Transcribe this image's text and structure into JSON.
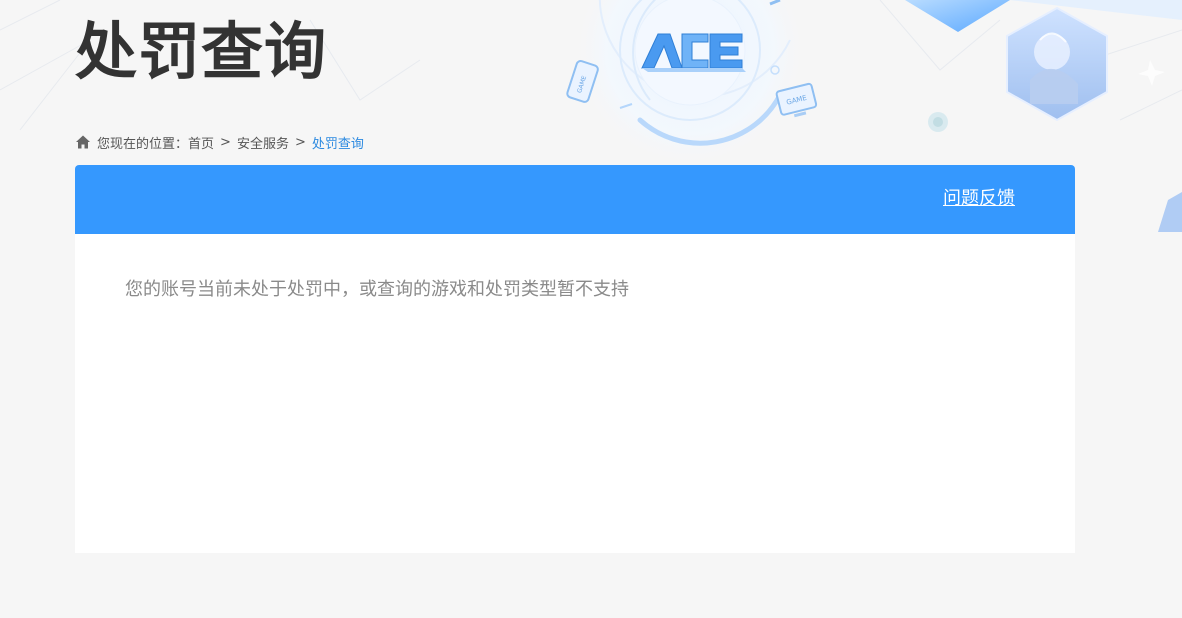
{
  "page": {
    "title": "处罚查询"
  },
  "breadcrumb": {
    "prefix": "您现在的位置：",
    "items": [
      "首页",
      "安全服务"
    ],
    "separator": ">",
    "current": "处罚查询"
  },
  "panel": {
    "feedback_label": "问题反馈",
    "message": "您的账号当前未处于处罚中，或查询的游戏和处罚类型暂不支持"
  },
  "decor": {
    "logo_text": "ACE",
    "game_badge_text": "GAME"
  },
  "colors": {
    "accent": "#3598fe",
    "link_current": "#2d8ae0",
    "title": "#333333",
    "page_bg": "#f6f6f6"
  },
  "icons": {
    "home": "home-icon",
    "logo": "ace-logo",
    "game_device": "game-device-icon"
  }
}
